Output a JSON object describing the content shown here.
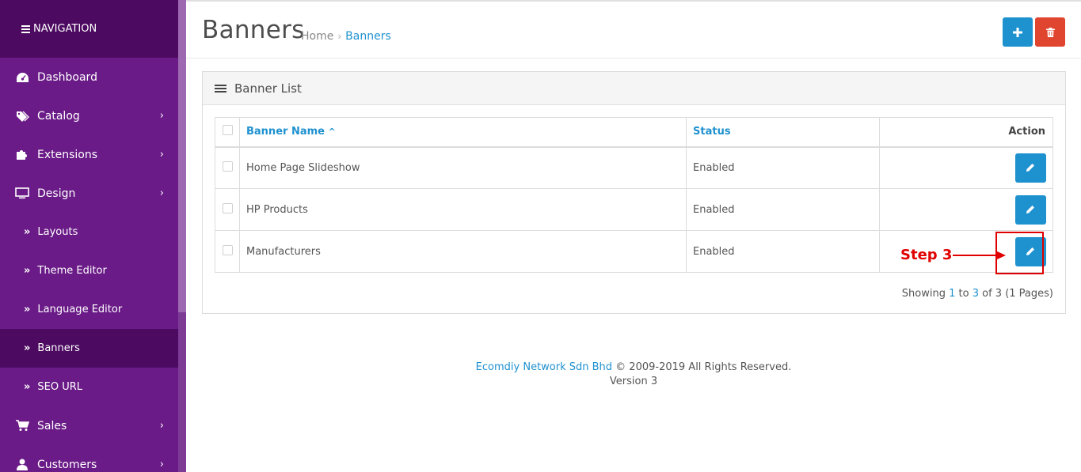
{
  "sidebar": {
    "title": "NAVIGATION",
    "items": [
      {
        "label": "Dashboard",
        "icon": "dashboard-icon",
        "has_children": false
      },
      {
        "label": "Catalog",
        "icon": "tags-icon",
        "has_children": true
      },
      {
        "label": "Extensions",
        "icon": "puzzle-icon",
        "has_children": true
      },
      {
        "label": "Design",
        "icon": "monitor-icon",
        "has_children": true
      }
    ],
    "design_children": [
      "Layouts",
      "Theme Editor",
      "Language Editor",
      "Banners",
      "SEO URL"
    ],
    "active_child": "Banners",
    "more_items": [
      {
        "label": "Sales",
        "icon": "cart-icon",
        "has_children": true
      },
      {
        "label": "Customers",
        "icon": "user-icon",
        "has_children": true
      }
    ]
  },
  "header": {
    "title": "Banners",
    "breadcrumb": {
      "home": "Home",
      "separator": "›",
      "current": "Banners"
    },
    "add_button_icon": "plus-icon",
    "delete_button_icon": "trash-icon"
  },
  "panel": {
    "title": "Banner List",
    "columns": {
      "name": "Banner Name",
      "sort_arrow": "^",
      "status": "Status",
      "action": "Action"
    },
    "rows": [
      {
        "name": "Home Page Slideshow",
        "status": "Enabled"
      },
      {
        "name": "HP Products",
        "status": "Enabled"
      },
      {
        "name": "Manufacturers",
        "status": "Enabled"
      }
    ],
    "pagination": {
      "prefix": "Showing ",
      "from": "1",
      "to_word": " to ",
      "to": "3",
      "of_word": " of ",
      "total": "3",
      "pages": " (1 Pages)"
    }
  },
  "annotation": {
    "label": "Step 3",
    "color": "#e00000"
  },
  "footer": {
    "company": "Ecomdiy Network Sdn Bhd",
    "rights": " © 2009-2019 All Rights Reserved.",
    "version": "Version 3"
  },
  "colors": {
    "sidebar": "#6a1b87",
    "sidebar_dark": "#4c0a60",
    "primary": "#1e91cf",
    "danger": "#e0452f"
  }
}
